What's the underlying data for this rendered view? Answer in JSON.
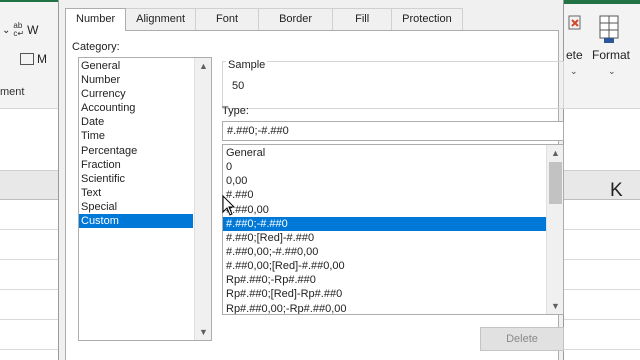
{
  "window": {
    "left_ribbon": {
      "item1_label": "W",
      "item2_label": "M",
      "group_label": "ment",
      "icon1": "ab-c-icon"
    },
    "right_ribbon": {
      "delete_label": "ete",
      "format_label": "Format",
      "column_header": "K"
    },
    "colors": {
      "excel_green": "#217346",
      "selection": "#0078d7"
    }
  },
  "dialog": {
    "tabs": [
      "Number",
      "Alignment",
      "Font",
      "Border",
      "Fill",
      "Protection"
    ],
    "active_tab": "Number",
    "category_label": "Category:",
    "categories": [
      "General",
      "Number",
      "Currency",
      "Accounting",
      "Date",
      "Time",
      "Percentage",
      "Fraction",
      "Scientific",
      "Text",
      "Special",
      "Custom"
    ],
    "selected_category": "Custom",
    "sample_label": "Sample",
    "sample_value": "50",
    "type_label": "Type:",
    "type_value": "#.##0;-#.##0",
    "formats": [
      "General",
      "0",
      "0,00",
      "#.##0",
      "#.##0,00",
      "#.##0;-#.##0",
      "#.##0;[Red]-#.##0",
      "#.##0,00;-#.##0,00",
      "#.##0,00;[Red]-#.##0,00",
      "Rp#.##0;-Rp#.##0",
      "Rp#.##0;[Red]-Rp#.##0",
      "Rp#.##0,00;-Rp#.##0,00"
    ],
    "selected_format": "#.##0;-#.##0",
    "delete_label": "Delete"
  }
}
